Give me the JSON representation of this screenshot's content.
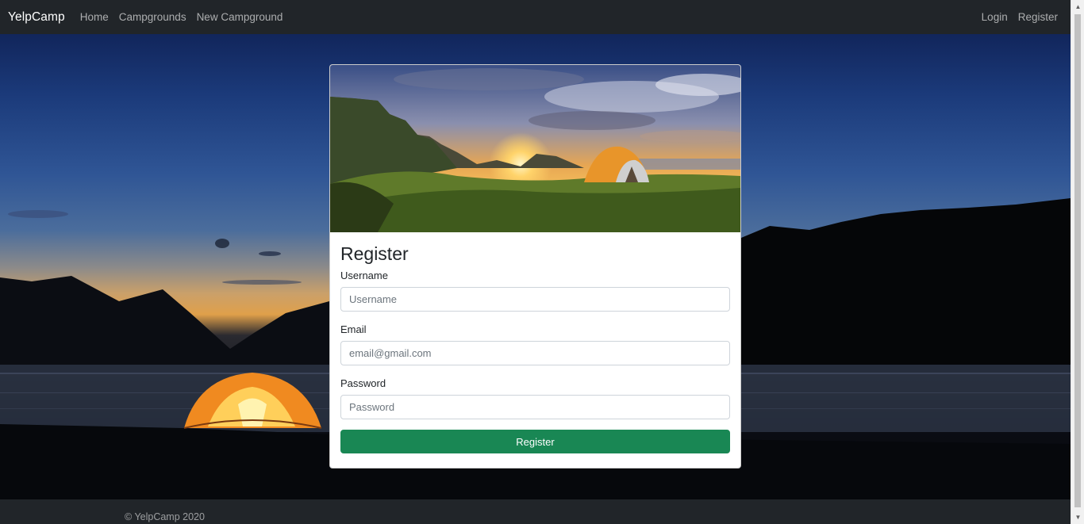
{
  "navbar": {
    "brand": "YelpCamp",
    "links": [
      "Home",
      "Campgrounds",
      "New Campground"
    ],
    "right_links": [
      "Login",
      "Register"
    ]
  },
  "card": {
    "title": "Register",
    "fields": {
      "username": {
        "label": "Username",
        "placeholder": "Username"
      },
      "email": {
        "label": "Email",
        "placeholder": "email@gmail.com"
      },
      "password": {
        "label": "Password",
        "placeholder": "Password"
      }
    },
    "submit_label": "Register"
  },
  "footer": {
    "text": "© YelpCamp 2020"
  },
  "colors": {
    "navbar_bg": "#212529",
    "submit_bg": "#198754",
    "brand_text": "#ffffff"
  },
  "icons": {
    "scroll_up": "scroll-up-arrow-icon",
    "scroll_down": "scroll-down-arrow-icon"
  }
}
